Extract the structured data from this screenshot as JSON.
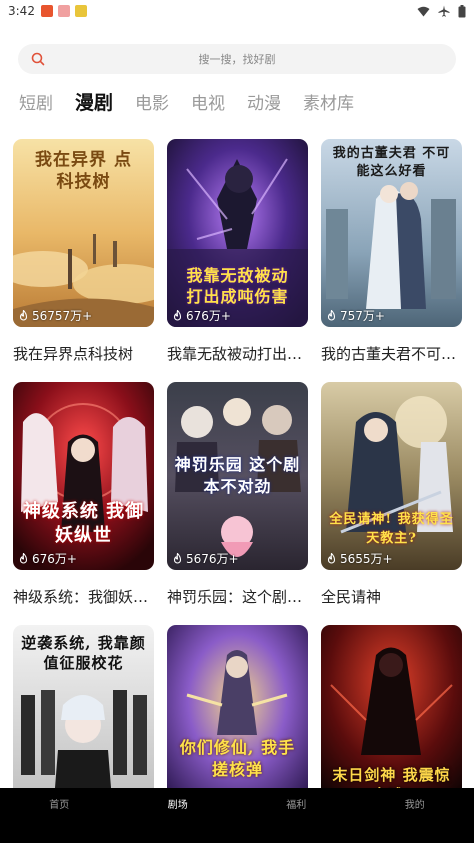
{
  "status_bar": {
    "time": "3:42",
    "notification_icons": [
      "app-notification-icon-1",
      "app-notification-icon-2",
      "app-notification-icon-3"
    ],
    "right_icons": [
      "wifi-icon",
      "airplane-mode-icon",
      "battery-icon"
    ]
  },
  "search": {
    "placeholder": "搜一搜，找好剧",
    "icon": "search-icon"
  },
  "tabs": [
    {
      "label": "短剧",
      "active": false
    },
    {
      "label": "漫剧",
      "active": true
    },
    {
      "label": "电影",
      "active": false
    },
    {
      "label": "电视",
      "active": false
    },
    {
      "label": "动漫",
      "active": false
    },
    {
      "label": "素材库",
      "active": false
    }
  ],
  "cards": [
    {
      "title": "我在异界点科技树",
      "views": "56757万+",
      "poster_text": "我在异界 点科技树"
    },
    {
      "title": "我靠无敌被动打出成吨伤害",
      "views": "676万+",
      "poster_text": "我靠无敌被动 打出成吨伤害"
    },
    {
      "title": "我的古董夫君不可能这么好看",
      "views": "757万+",
      "poster_text": "我的古董夫君 不可能这么好看"
    },
    {
      "title": "神级系统：我御妖纵世",
      "views": "676万+",
      "poster_text": "神级系统 我御妖纵世"
    },
    {
      "title": "神罚乐园：这个剧本不对劲",
      "views": "5676万+",
      "poster_text": "神罚乐园 这个剧本不对劲"
    },
    {
      "title": "全民请神",
      "views": "5655万+",
      "poster_text": "全民请神! 我获得圣天教主?"
    },
    {
      "title": "",
      "views": "",
      "poster_text": "逆袭系统, 我靠颜值征服校花"
    },
    {
      "title": "",
      "views": "",
      "poster_text": "你们修仙, 我手搓核弹"
    },
    {
      "title": "",
      "views": "",
      "poster_text": "末日剑神 我震惊全球!"
    }
  ],
  "bottom_nav": [
    {
      "label": "首页",
      "active": false
    },
    {
      "label": "剧场",
      "active": true
    },
    {
      "label": "福利",
      "active": false
    },
    {
      "label": "我的",
      "active": false
    }
  ],
  "colors": {
    "accent_search_icon": "#e0523a",
    "tab_active": "#111111",
    "tab_inactive": "#9a9a9a",
    "nav_background": "#000000"
  }
}
